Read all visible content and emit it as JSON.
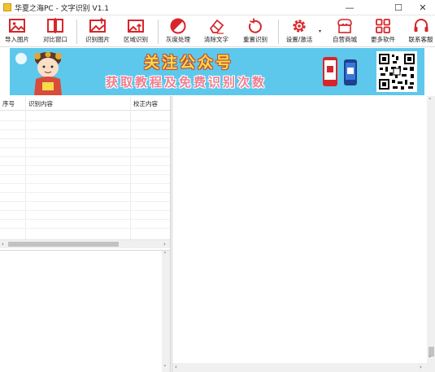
{
  "window": {
    "title": "华夏之海PC - 文字识别 V1.1",
    "minimize": "—",
    "maximize": "☐",
    "close": "✕"
  },
  "toolbar": {
    "import_image": "导入图片",
    "compare_window": "对比窗口",
    "recognize_image": "识别图片",
    "region_recognize": "区域识别",
    "grayscale": "灰度处理",
    "clear_text": "清除文字",
    "re_recognize": "重置识别",
    "settings": "设置/激活",
    "settings_dropdown": "▾",
    "store": "自营商城",
    "more_software": "更多软件",
    "contact_support": "联系客服"
  },
  "banner": {
    "headline": "关注公众号",
    "subheadline": "获取教程及免费识别次数"
  },
  "result_table": {
    "columns": [
      "序号",
      "识别内容",
      "校正内容"
    ]
  },
  "colors": {
    "icon_red": "#d7262b",
    "banner_bg": "#5ec8ec"
  }
}
